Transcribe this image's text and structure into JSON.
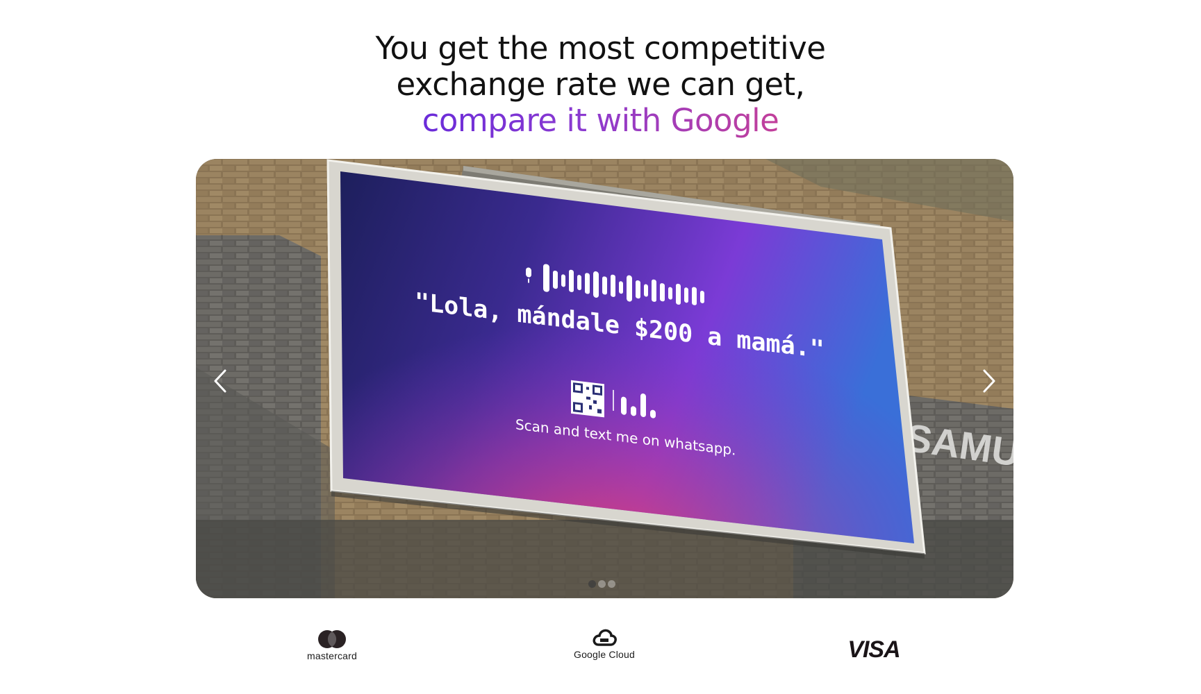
{
  "headline": {
    "line1": "You get the most competitive",
    "line2": "exchange rate we can get,",
    "line3": "compare it with Google",
    "accent_gradient": [
      "#6a2bd9",
      "#c23f9a"
    ]
  },
  "carousel": {
    "slide": {
      "billboard_quote": "\"Lola, mándale $200 a mamá.\"",
      "billboard_caption": "Scan and text me on whatsapp.",
      "wall_graffiti": "SAMU",
      "icons": [
        "microphone-icon",
        "voice-waveform",
        "qr-code",
        "brand-logo"
      ]
    },
    "prev_icon": "chevron-left-icon",
    "next_icon": "chevron-right-icon",
    "slide_count": 3,
    "active_slide": 1
  },
  "partners": [
    {
      "name": "mastercard",
      "icon": "mastercard-logo"
    },
    {
      "name": "Google Cloud",
      "icon": "google-cloud-logo"
    },
    {
      "name": "VISA",
      "icon": "visa-logo"
    }
  ]
}
